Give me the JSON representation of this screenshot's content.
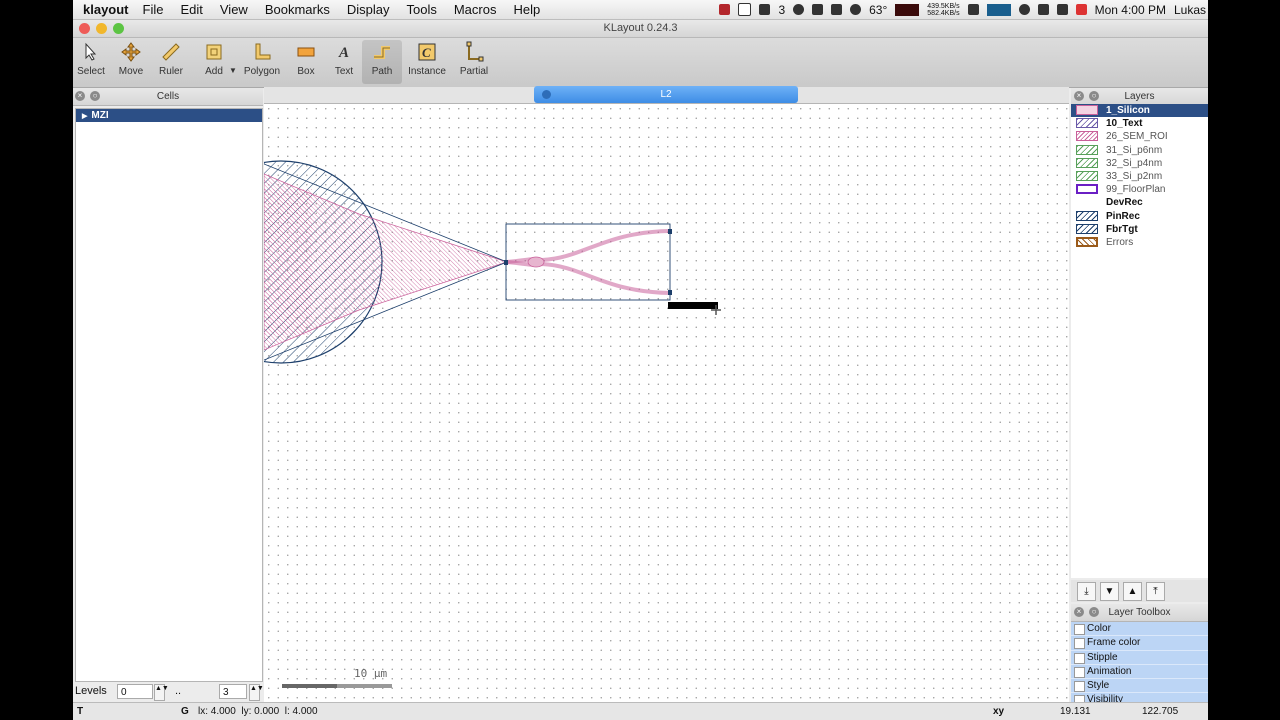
{
  "menubar": {
    "app_name": "klayout",
    "items": [
      "File",
      "Edit",
      "View",
      "Bookmarks",
      "Display",
      "Tools",
      "Macros",
      "Help"
    ],
    "tray_count": "3",
    "temperature": "63°",
    "net_up": "439.5KB/s",
    "net_down": "582.4KB/s",
    "clock": "Mon 4:00 PM",
    "user": "Lukas"
  },
  "window": {
    "title": "KLayout 0.24.3"
  },
  "toolbar": {
    "tools": [
      {
        "label": "Select",
        "icon": "select-arrow-icon"
      },
      {
        "label": "Move",
        "icon": "move-cross-icon"
      },
      {
        "label": "Ruler",
        "icon": "ruler-icon"
      },
      {
        "label": "Add",
        "icon": "add-icon"
      },
      {
        "label": "Polygon",
        "icon": "polygon-icon"
      },
      {
        "label": "Box",
        "icon": "box-icon"
      },
      {
        "label": "Text",
        "icon": "text-icon"
      },
      {
        "label": "Path",
        "icon": "path-icon"
      },
      {
        "label": "Instance",
        "icon": "instance-icon"
      },
      {
        "label": "Partial",
        "icon": "partial-icon"
      }
    ],
    "active": "Path"
  },
  "cells_panel": {
    "title": "Cells",
    "items": [
      "MZI"
    ]
  },
  "view_tab": {
    "label": "L2"
  },
  "layers_panel": {
    "title": "Layers",
    "items": [
      {
        "name": "1_Silicon",
        "bold": true,
        "selected": true,
        "color": "#c9609a"
      },
      {
        "name": "10_Text",
        "bold": true,
        "selected": false,
        "color": "#6a5aa8"
      },
      {
        "name": "26_SEM_ROI",
        "bold": false,
        "selected": false,
        "color": "#c9609a"
      },
      {
        "name": "31_Si_p6nm",
        "bold": false,
        "selected": false,
        "color": "#58a05a"
      },
      {
        "name": "32_Si_p4nm",
        "bold": false,
        "selected": false,
        "color": "#58a05a"
      },
      {
        "name": "33_Si_p2nm",
        "bold": false,
        "selected": false,
        "color": "#58a05a"
      },
      {
        "name": "99_FloorPlan",
        "bold": false,
        "selected": false,
        "color": "#6a1fc4"
      },
      {
        "name": "DevRec",
        "bold": true,
        "selected": false,
        "color": "#ffffff"
      },
      {
        "name": "PinRec",
        "bold": true,
        "selected": false,
        "color": "#1d3f6b"
      },
      {
        "name": "FbrTgt",
        "bold": true,
        "selected": false,
        "color": "#1d3f6b"
      },
      {
        "name": "Errors",
        "bold": false,
        "selected": false,
        "color": "#9a5a1a"
      }
    ]
  },
  "layer_toolbox": {
    "title": "Layer Toolbox",
    "items": [
      "Color",
      "Frame color",
      "Stipple",
      "Animation",
      "Style",
      "Visibility"
    ]
  },
  "levels": {
    "label": "Levels",
    "from": "0",
    "sep": "..",
    "to": "3"
  },
  "scale_bar": {
    "label": "10 µm"
  },
  "status": {
    "left": "T",
    "mode": "G",
    "measure": "lx: 4.000  ly: 0.000  l: 4.000",
    "coord_label": "xy",
    "x": "19.131",
    "y": "122.705"
  },
  "colors": {
    "selection": "#2c4f86",
    "tab": "#4a96ea",
    "silicon": "#c9609a",
    "pinrec": "#1d3f6b"
  }
}
